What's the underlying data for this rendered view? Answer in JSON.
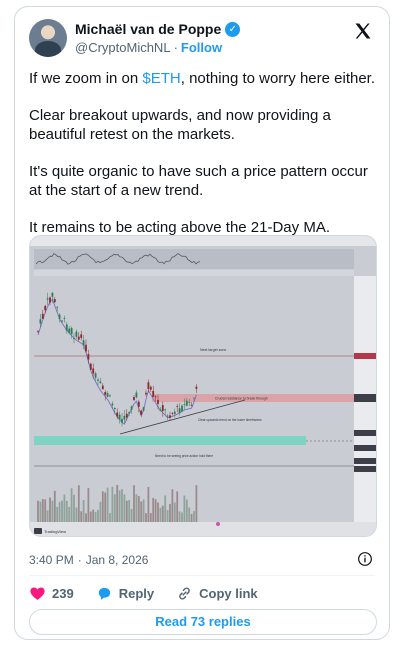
{
  "author": {
    "name": "Michaël van de Poppe",
    "handle": "@CryptoMichNL",
    "separator": "·",
    "follow_label": "Follow"
  },
  "tweet": {
    "line1_pre": "If we zoom in on ",
    "cashtag": "$ETH",
    "line1_post": ", nothing to worry here either.",
    "para2": "Clear breakout upwards, and now providing a beautiful retest on the markets.",
    "para3": "It's quite organic to have such a price pattern occur at the start of a new trend.",
    "para4": "It remains to be acting above the 21-Day MA."
  },
  "chart_annotations": {
    "target": "Next target zone",
    "breakout": "Crucial resistance to break through",
    "support": "Clear upwards trend on the lower timeframes",
    "need": "Need to be seeing price action hold there",
    "brand": "TradingView"
  },
  "meta": {
    "time": "3:40 PM",
    "separator": "·",
    "date": "Jan 8, 2026"
  },
  "actions": {
    "like_count": "239",
    "reply_label": "Reply",
    "copy_label": "Copy link",
    "read_replies": "Read 73 replies"
  },
  "colors": {
    "accent": "#1d9bf0",
    "like": "#f91880",
    "chart_bg": "#c9ccd3",
    "candle_up": "#2e7d52",
    "candle_down": "#8a2a2a",
    "zone_red": "#d9a3a8",
    "zone_teal": "#7fd3c3"
  },
  "icons": {
    "verified": "verified-badge-icon",
    "x": "x-logo-icon",
    "info": "info-icon",
    "heart": "heart-icon",
    "reply": "reply-icon",
    "link": "link-icon"
  }
}
